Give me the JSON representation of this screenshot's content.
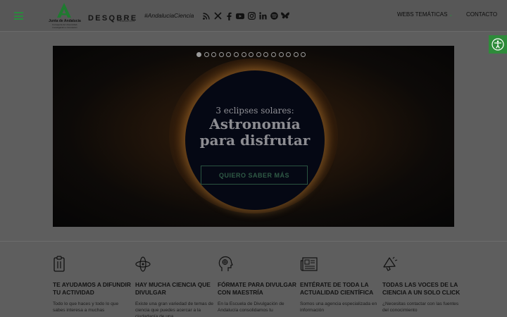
{
  "header": {
    "logo_ja": {
      "name": "Junta de Andalucía",
      "sub": "Consejería de Universidad, Investigación e Innovación"
    },
    "logo_descubre": {
      "word": "DESQBRE",
      "sub": "FUNDACIÓN"
    },
    "hashtag": "#AndaluciaCiencia",
    "socials": [
      "rss-icon",
      "x-icon",
      "facebook-icon",
      "youtube-icon",
      "instagram-icon",
      "linkedin-icon",
      "spotify-icon",
      "bluesky-icon"
    ],
    "nav": {
      "webs": "WEBS TEMÁTICAS",
      "contact": "CONTACTO"
    }
  },
  "hero": {
    "subtitle": "3 eclipses solares:",
    "title_line1": "Astronomía",
    "title_line2": "para disfrutar",
    "button": "QUIERO SABER MÁS",
    "slides_total": 15,
    "active_slide": 1
  },
  "features": [
    {
      "icon": "clipboard-icon",
      "title": "TE AYUDAMOS A DIFUNDIR TU ACTIVIDAD",
      "desc": "Todo lo que haces y todo lo que sabes interesa a muchas"
    },
    {
      "icon": "atom-icon",
      "title": "HAY MUCHA CIENCIA QUE DIVULGAR",
      "desc": "Existe una gran variedad de temas de ciencia que puedes acercar a la ciudadanía de una"
    },
    {
      "icon": "head-brain-icon",
      "title": "FÓRMATE PARA DIVULGAR CON MAESTRÍA",
      "desc": "En la Escuela de Divulgación de Andalucía consolidamos tu"
    },
    {
      "icon": "newspaper-icon",
      "title": "ENTÉRATE DE TODA LA ACTUALIDAD CIENTÍFICA",
      "desc": "Somos una agencia especializada en información"
    },
    {
      "icon": "megaphone-icon",
      "title": "TODAS LAS VOCES DE LA CIENCIA A UN SOLO CLICK",
      "desc": "¿Necesitas contactar con las fuentes del conocimiento"
    }
  ],
  "colors": {
    "accent": "#2b8a3e",
    "overlay": "#5e5e5e"
  }
}
